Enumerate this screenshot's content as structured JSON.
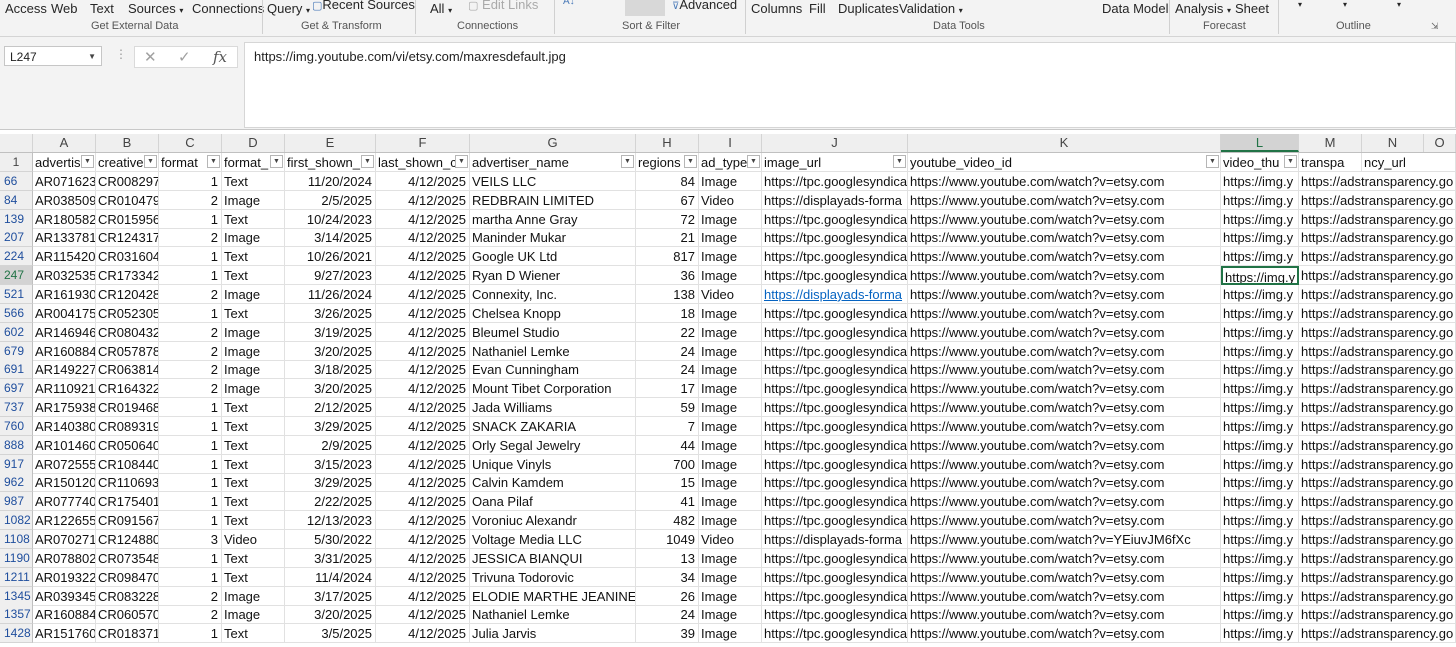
{
  "ribbon": {
    "items": [
      "Access",
      "Web",
      "Text",
      "Sources",
      "Connections",
      "Query",
      "Recent Sources",
      "All",
      "Edit Links",
      "Advanced",
      "Columns",
      "Fill",
      "Duplicates",
      "Validation",
      "Data Model",
      "Analysis",
      "Sheet"
    ],
    "groups": [
      "Get External Data",
      "Get & Transform",
      "Connections",
      "Sort & Filter",
      "Data Tools",
      "Forecast",
      "Outline"
    ]
  },
  "formula_bar": {
    "name_box": "L247",
    "formula": "https://img.youtube.com/vi/etsy.com/maxresdefault.jpg",
    "icons": [
      "cancel-icon",
      "enter-icon",
      "function-icon"
    ]
  },
  "sheet": {
    "col_letters": [
      "A",
      "B",
      "C",
      "D",
      "E",
      "F",
      "G",
      "H",
      "I",
      "J",
      "K",
      "L",
      "M",
      "N",
      "O"
    ],
    "header_row_number": "1",
    "headers": [
      "advertis",
      "creative",
      "format",
      "format_",
      "first_shown_",
      "last_shown_c",
      "advertiser_name",
      "regions",
      "ad_type",
      "image_url",
      "youtube_video_id",
      "video_thu",
      "transpa",
      "ncy_url"
    ],
    "rows": [
      {
        "n": "66",
        "a": "AR071623",
        "b": "CR008297",
        "c": "1",
        "d": "Text",
        "e": "11/20/2024",
        "f": "4/12/2025",
        "g": "VEILS LLC",
        "h": "84",
        "i": "Image",
        "j": "https://tpc.googlesyndica",
        "k": "https://www.youtube.com/watch?v=etsy.com",
        "l": "https://img.y",
        "m": "https://adstransparency.go"
      },
      {
        "n": "84",
        "a": "AR038509",
        "b": "CR010479",
        "c": "2",
        "d": "Image",
        "e": "2/5/2025",
        "f": "4/12/2025",
        "g": "REDBRAIN LIMITED",
        "h": "67",
        "i": "Video",
        "j": "https://displayads-forma",
        "k": "https://www.youtube.com/watch?v=etsy.com",
        "l": "https://img.y",
        "m": "https://adstransparency.go"
      },
      {
        "n": "139",
        "a": "AR180582",
        "b": "CR015956",
        "c": "1",
        "d": "Text",
        "e": "10/24/2023",
        "f": "4/12/2025",
        "g": "martha Anne Gray",
        "h": "72",
        "i": "Image",
        "j": "https://tpc.googlesyndica",
        "k": "https://www.youtube.com/watch?v=etsy.com",
        "l": "https://img.y",
        "m": "https://adstransparency.go"
      },
      {
        "n": "207",
        "a": "AR133781",
        "b": "CR124317",
        "c": "2",
        "d": "Image",
        "e": "3/14/2025",
        "f": "4/12/2025",
        "g": "Maninder Mukar",
        "h": "21",
        "i": "Image",
        "j": "https://tpc.googlesyndica",
        "k": "https://www.youtube.com/watch?v=etsy.com",
        "l": "https://img.y",
        "m": "https://adstransparency.go"
      },
      {
        "n": "224",
        "a": "AR115420",
        "b": "CR031604",
        "c": "1",
        "d": "Text",
        "e": "10/26/2021",
        "f": "4/12/2025",
        "g": "Google UK Ltd",
        "h": "817",
        "i": "Image",
        "j": "https://tpc.googlesyndica",
        "k": "https://www.youtube.com/watch?v=etsy.com",
        "l": "https://img.y",
        "m": "https://adstransparency.go"
      },
      {
        "n": "247",
        "a": "AR032535",
        "b": "CR173342",
        "c": "1",
        "d": "Text",
        "e": "9/27/2023",
        "f": "4/12/2025",
        "g": "Ryan D Wiener",
        "h": "36",
        "i": "Image",
        "j": "https://tpc.googlesyndica",
        "k": "https://www.youtube.com/watch?v=etsy.com",
        "l": "https://img.y",
        "m": "https://adstransparency.go"
      },
      {
        "n": "521",
        "a": "AR161930",
        "b": "CR120428",
        "c": "2",
        "d": "Image",
        "e": "11/26/2024",
        "f": "4/12/2025",
        "g": "Connexity, Inc.",
        "h": "138",
        "i": "Video",
        "j": "https://displayads-forma",
        "k": "https://www.youtube.com/watch?v=etsy.com",
        "l": "https://img.y",
        "m": "https://adstransparency.go"
      },
      {
        "n": "566",
        "a": "AR004175",
        "b": "CR052305",
        "c": "1",
        "d": "Text",
        "e": "3/26/2025",
        "f": "4/12/2025",
        "g": "Chelsea Knopp",
        "h": "18",
        "i": "Image",
        "j": "https://tpc.googlesyndica",
        "k": "https://www.youtube.com/watch?v=etsy.com",
        "l": "https://img.y",
        "m": "https://adstransparency.go"
      },
      {
        "n": "602",
        "a": "AR146946",
        "b": "CR080432",
        "c": "2",
        "d": "Image",
        "e": "3/19/2025",
        "f": "4/12/2025",
        "g": "Bleumel Studio",
        "h": "22",
        "i": "Image",
        "j": "https://tpc.googlesyndica",
        "k": "https://www.youtube.com/watch?v=etsy.com",
        "l": "https://img.y",
        "m": "https://adstransparency.go"
      },
      {
        "n": "679",
        "a": "AR160884",
        "b": "CR057878",
        "c": "2",
        "d": "Image",
        "e": "3/20/2025",
        "f": "4/12/2025",
        "g": "Nathaniel Lemke",
        "h": "24",
        "i": "Image",
        "j": "https://tpc.googlesyndica",
        "k": "https://www.youtube.com/watch?v=etsy.com",
        "l": "https://img.y",
        "m": "https://adstransparency.go"
      },
      {
        "n": "691",
        "a": "AR149227",
        "b": "CR063814",
        "c": "2",
        "d": "Image",
        "e": "3/18/2025",
        "f": "4/12/2025",
        "g": "Evan Cunningham",
        "h": "24",
        "i": "Image",
        "j": "https://tpc.googlesyndica",
        "k": "https://www.youtube.com/watch?v=etsy.com",
        "l": "https://img.y",
        "m": "https://adstransparency.go"
      },
      {
        "n": "697",
        "a": "AR110921",
        "b": "CR164322",
        "c": "2",
        "d": "Image",
        "e": "3/20/2025",
        "f": "4/12/2025",
        "g": "Mount Tibet Corporation",
        "h": "17",
        "i": "Image",
        "j": "https://tpc.googlesyndica",
        "k": "https://www.youtube.com/watch?v=etsy.com",
        "l": "https://img.y",
        "m": "https://adstransparency.go"
      },
      {
        "n": "737",
        "a": "AR175938",
        "b": "CR019468",
        "c": "1",
        "d": "Text",
        "e": "2/12/2025",
        "f": "4/12/2025",
        "g": "Jada Williams",
        "h": "59",
        "i": "Image",
        "j": "https://tpc.googlesyndica",
        "k": "https://www.youtube.com/watch?v=etsy.com",
        "l": "https://img.y",
        "m": "https://adstransparency.go"
      },
      {
        "n": "760",
        "a": "AR140380",
        "b": "CR089319",
        "c": "1",
        "d": "Text",
        "e": "3/29/2025",
        "f": "4/12/2025",
        "g": "SNACK ZAKARIA",
        "h": "7",
        "i": "Image",
        "j": "https://tpc.googlesyndica",
        "k": "https://www.youtube.com/watch?v=etsy.com",
        "l": "https://img.y",
        "m": "https://adstransparency.go"
      },
      {
        "n": "888",
        "a": "AR101460",
        "b": "CR050640",
        "c": "1",
        "d": "Text",
        "e": "2/9/2025",
        "f": "4/12/2025",
        "g": "Orly Segal Jewelry",
        "h": "44",
        "i": "Image",
        "j": "https://tpc.googlesyndica",
        "k": "https://www.youtube.com/watch?v=etsy.com",
        "l": "https://img.y",
        "m": "https://adstransparency.go"
      },
      {
        "n": "917",
        "a": "AR072555",
        "b": "CR108440",
        "c": "1",
        "d": "Text",
        "e": "3/15/2023",
        "f": "4/12/2025",
        "g": "Unique Vinyls",
        "h": "700",
        "i": "Image",
        "j": "https://tpc.googlesyndica",
        "k": "https://www.youtube.com/watch?v=etsy.com",
        "l": "https://img.y",
        "m": "https://adstransparency.go"
      },
      {
        "n": "962",
        "a": "AR150120",
        "b": "CR110693",
        "c": "1",
        "d": "Text",
        "e": "3/29/2025",
        "f": "4/12/2025",
        "g": "Calvin Kamdem",
        "h": "15",
        "i": "Image",
        "j": "https://tpc.googlesyndica",
        "k": "https://www.youtube.com/watch?v=etsy.com",
        "l": "https://img.y",
        "m": "https://adstransparency.go"
      },
      {
        "n": "987",
        "a": "AR077740",
        "b": "CR175401",
        "c": "1",
        "d": "Text",
        "e": "2/22/2025",
        "f": "4/12/2025",
        "g": "Oana Pilaf",
        "h": "41",
        "i": "Image",
        "j": "https://tpc.googlesyndica",
        "k": "https://www.youtube.com/watch?v=etsy.com",
        "l": "https://img.y",
        "m": "https://adstransparency.go"
      },
      {
        "n": "1082",
        "a": "AR122655",
        "b": "CR091567",
        "c": "1",
        "d": "Text",
        "e": "12/13/2023",
        "f": "4/12/2025",
        "g": "Voroniuc Alexandr",
        "h": "482",
        "i": "Image",
        "j": "https://tpc.googlesyndica",
        "k": "https://www.youtube.com/watch?v=etsy.com",
        "l": "https://img.y",
        "m": "https://adstransparency.go"
      },
      {
        "n": "1108",
        "a": "AR070271",
        "b": "CR124880",
        "c": "3",
        "d": "Video",
        "e": "5/30/2022",
        "f": "4/12/2025",
        "g": "Voltage Media LLC",
        "h": "1049",
        "i": "Video",
        "j": "https://displayads-forma",
        "k": "https://www.youtube.com/watch?v=YEiuvJM6fXc",
        "l": "https://img.y",
        "m": "https://adstransparency.go"
      },
      {
        "n": "1190",
        "a": "AR078802",
        "b": "CR073548",
        "c": "1",
        "d": "Text",
        "e": "3/31/2025",
        "f": "4/12/2025",
        "g": "JESSICA BIANQUI",
        "h": "13",
        "i": "Image",
        "j": "https://tpc.googlesyndica",
        "k": "https://www.youtube.com/watch?v=etsy.com",
        "l": "https://img.y",
        "m": "https://adstransparency.go"
      },
      {
        "n": "1211",
        "a": "AR019322",
        "b": "CR098470",
        "c": "1",
        "d": "Text",
        "e": "11/4/2024",
        "f": "4/12/2025",
        "g": "Trivuna Todorovic",
        "h": "34",
        "i": "Image",
        "j": "https://tpc.googlesyndica",
        "k": "https://www.youtube.com/watch?v=etsy.com",
        "l": "https://img.y",
        "m": "https://adstransparency.go"
      },
      {
        "n": "1345",
        "a": "AR039345",
        "b": "CR083228",
        "c": "2",
        "d": "Image",
        "e": "3/17/2025",
        "f": "4/12/2025",
        "g": "ELODIE MARTHE JEANINE LC",
        "h": "26",
        "i": "Image",
        "j": "https://tpc.googlesyndica",
        "k": "https://www.youtube.com/watch?v=etsy.com",
        "l": "https://img.y",
        "m": "https://adstransparency.go"
      },
      {
        "n": "1357",
        "a": "AR160884",
        "b": "CR060570",
        "c": "2",
        "d": "Image",
        "e": "3/20/2025",
        "f": "4/12/2025",
        "g": "Nathaniel Lemke",
        "h": "24",
        "i": "Image",
        "j": "https://tpc.googlesyndica",
        "k": "https://www.youtube.com/watch?v=etsy.com",
        "l": "https://img.y",
        "m": "https://adstransparency.go"
      },
      {
        "n": "1428",
        "a": "AR151760",
        "b": "CR018371",
        "c": "1",
        "d": "Text",
        "e": "3/5/2025",
        "f": "4/12/2025",
        "g": "Julia Jarvis",
        "h": "39",
        "i": "Image",
        "j": "https://tpc.googlesyndica",
        "k": "https://www.youtube.com/watch?v=etsy.com",
        "l": "https://img.y",
        "m": "https://adstransparency.go"
      }
    ]
  }
}
